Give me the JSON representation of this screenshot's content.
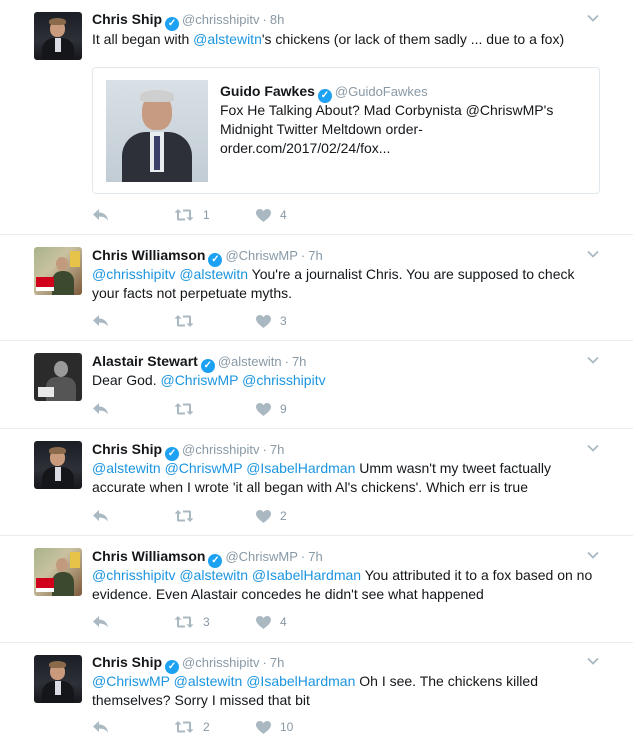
{
  "tweets": [
    {
      "name": "Chris Ship",
      "handle": "@chrisshipitv",
      "time": "8h",
      "text_parts": [
        "It all began with ",
        "@alstewitn",
        "'s chickens (or lack of them sadly ... due to a fox)"
      ],
      "quote": {
        "name": "Guido Fawkes",
        "handle": "@GuidoFawkes",
        "text": "Fox He Talking About? Mad Corbynista @ChriswMP's Midnight Twitter Meltdown order-order.com/2017/02/24/fox..."
      },
      "retweets": "1",
      "likes": "4"
    },
    {
      "name": "Chris Williamson",
      "handle": "@ChriswMP",
      "time": "7h",
      "text_parts": [
        "@chrisshipitv",
        " ",
        "@alstewitn",
        " You're a journalist Chris. You are supposed to check your facts not perpetuate myths."
      ],
      "retweets": "",
      "likes": "3"
    },
    {
      "name": "Alastair Stewart",
      "handle": "@alstewitn",
      "time": "7h",
      "text_parts": [
        "Dear God. ",
        "@ChriswMP",
        " ",
        "@chrisshipitv"
      ],
      "retweets": "",
      "likes": "9"
    },
    {
      "name": "Chris Ship",
      "handle": "@chrisshipitv",
      "time": "7h",
      "text_parts": [
        "@alstewitn",
        " ",
        "@ChriswMP",
        " ",
        "@IsabelHardman",
        " Umm wasn't my tweet factually accurate when I wrote 'it all began with Al's chickens'. Which err is true"
      ],
      "retweets": "",
      "likes": "2"
    },
    {
      "name": "Chris Williamson",
      "handle": "@ChriswMP",
      "time": "7h",
      "text_parts": [
        "@chrisshipitv",
        " ",
        "@alstewitn",
        " ",
        "@IsabelHardman",
        " You attributed it to a fox based on no evidence. Even Alastair concedes he didn't see what happened"
      ],
      "retweets": "3",
      "likes": "4"
    },
    {
      "name": "Chris Ship",
      "handle": "@chrisshipitv",
      "time": "7h",
      "text_parts": [
        "@ChriswMP",
        " ",
        "@alstewitn",
        " ",
        "@IsabelHardman",
        " Oh I see. The chickens killed themselves? Sorry I missed that bit"
      ],
      "retweets": "2",
      "likes": "10"
    }
  ],
  "separator": "·",
  "verified_glyph": "✓",
  "icons": {
    "reply": "reply-icon",
    "retweet": "retweet-icon",
    "like": "heart-icon",
    "menu": "chevron-down-icon",
    "verified": "verified-badge-icon"
  },
  "colors": {
    "link": "#1b95e0",
    "muted": "#8899a6",
    "icon": "#aab8c2",
    "verified": "#1da1f2"
  }
}
